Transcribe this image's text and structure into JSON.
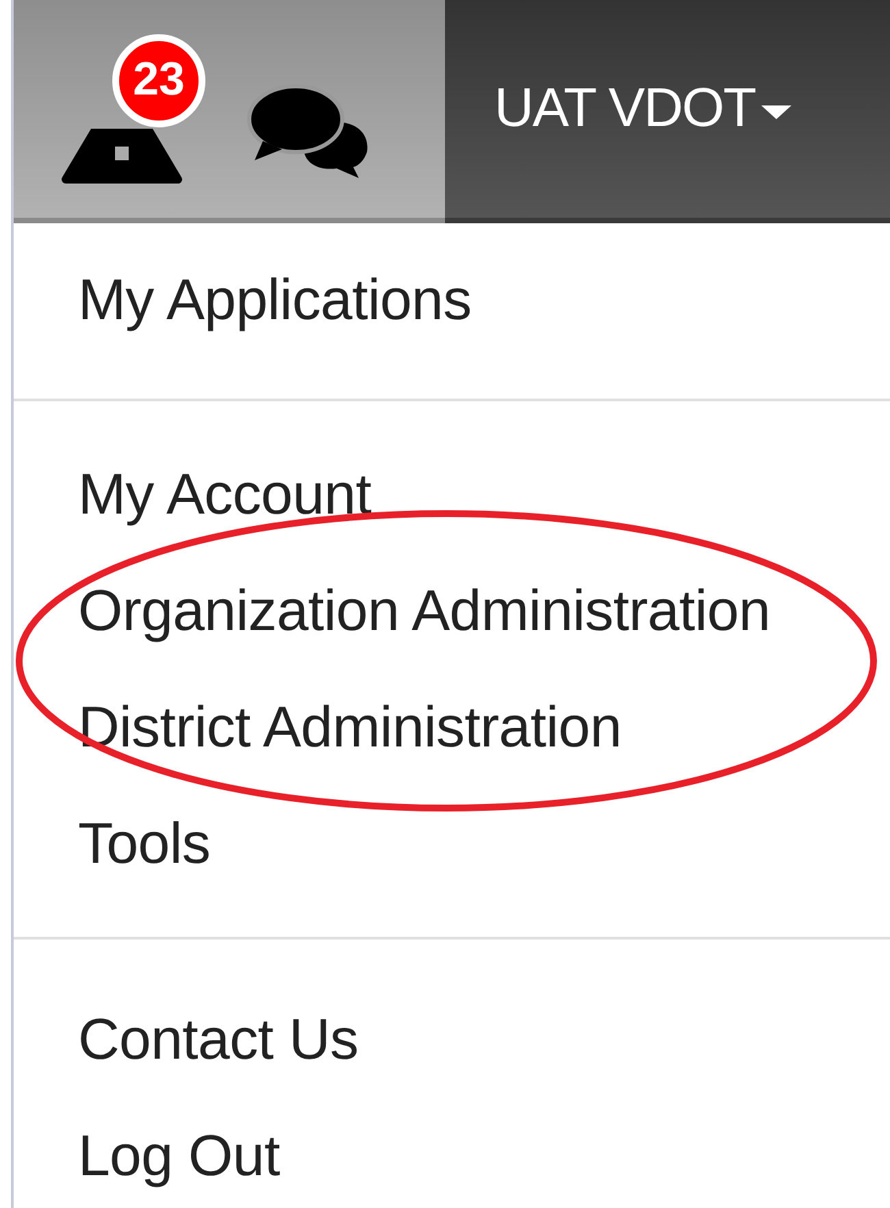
{
  "top_bar": {
    "alert_badge": "23",
    "user_menu": {
      "label": "UAT VDOT"
    }
  },
  "menu": {
    "sections": [
      {
        "items": [
          {
            "label": "My Applications",
            "highlighted": false
          }
        ]
      },
      {
        "items": [
          {
            "label": "My Account",
            "highlighted": false
          },
          {
            "label": "Organization Administration",
            "highlighted": true
          },
          {
            "label": "District Administration",
            "highlighted": true
          },
          {
            "label": "Tools",
            "highlighted": false
          }
        ]
      },
      {
        "items": [
          {
            "label": "Contact Us",
            "highlighted": false
          },
          {
            "label": "Log Out",
            "highlighted": false
          }
        ]
      }
    ]
  }
}
